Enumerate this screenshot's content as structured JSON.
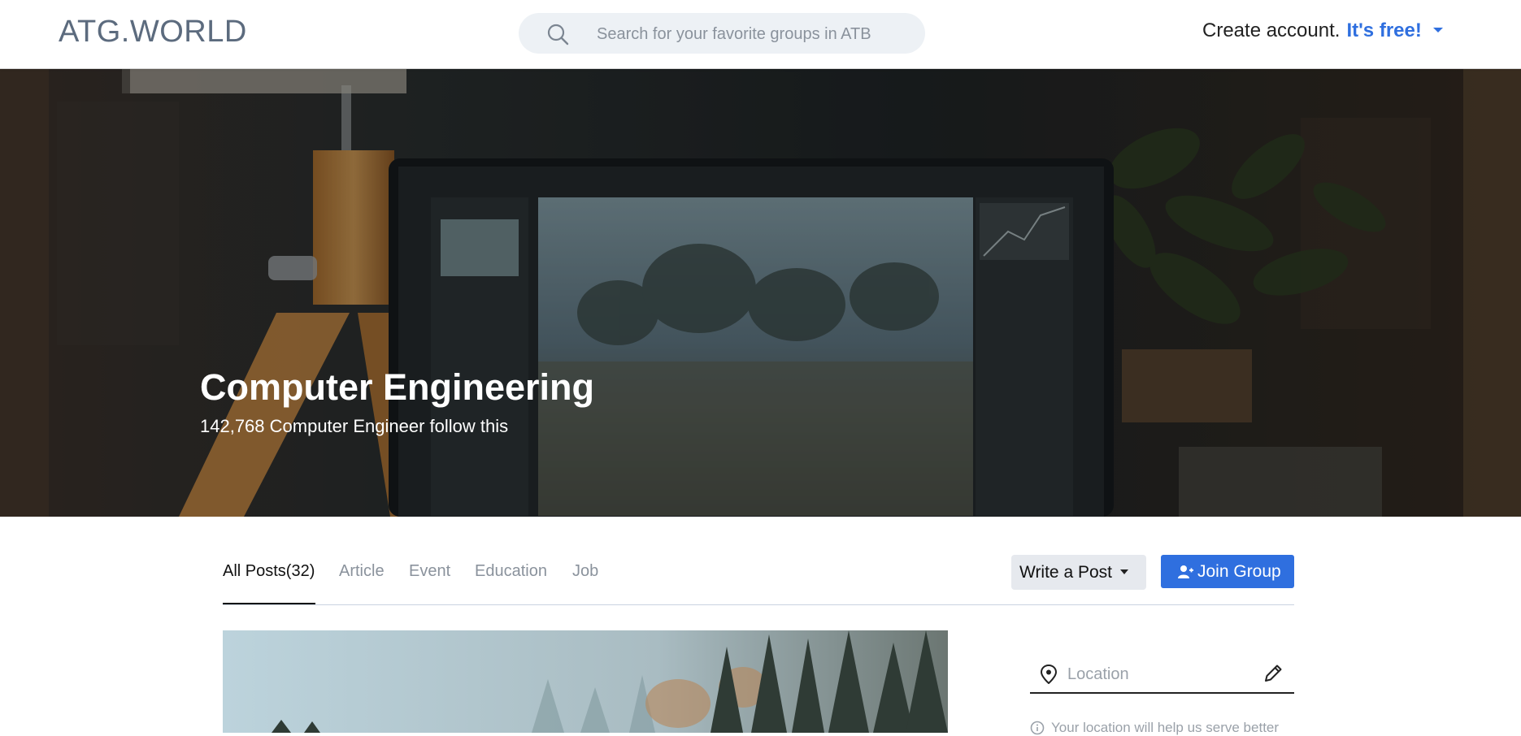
{
  "header": {
    "logo": "ATG.WORLD",
    "search_placeholder": "Search for your favorite groups in ATB",
    "create_account": "Create account.",
    "its_free": "It's free!"
  },
  "hero": {
    "title": "Computer Engineering",
    "subtitle": "142,768 Computer Engineer follow this"
  },
  "tabs": [
    {
      "label": "All Posts(32)",
      "active": true
    },
    {
      "label": "Article",
      "active": false
    },
    {
      "label": "Event",
      "active": false
    },
    {
      "label": "Education",
      "active": false
    },
    {
      "label": "Job",
      "active": false
    }
  ],
  "actions": {
    "write_post": "Write a Post",
    "join_group": "Join Group"
  },
  "sidebar": {
    "location_placeholder": "Location",
    "location_hint": "Your location will help us serve better"
  },
  "colors": {
    "accent": "#2f6fdf",
    "logo": "#5c6b7e",
    "muted": "#8a929c"
  },
  "icons": [
    "search-icon",
    "chevron-down-icon",
    "add-user-icon",
    "location-pin-icon",
    "pencil-icon",
    "info-icon"
  ]
}
